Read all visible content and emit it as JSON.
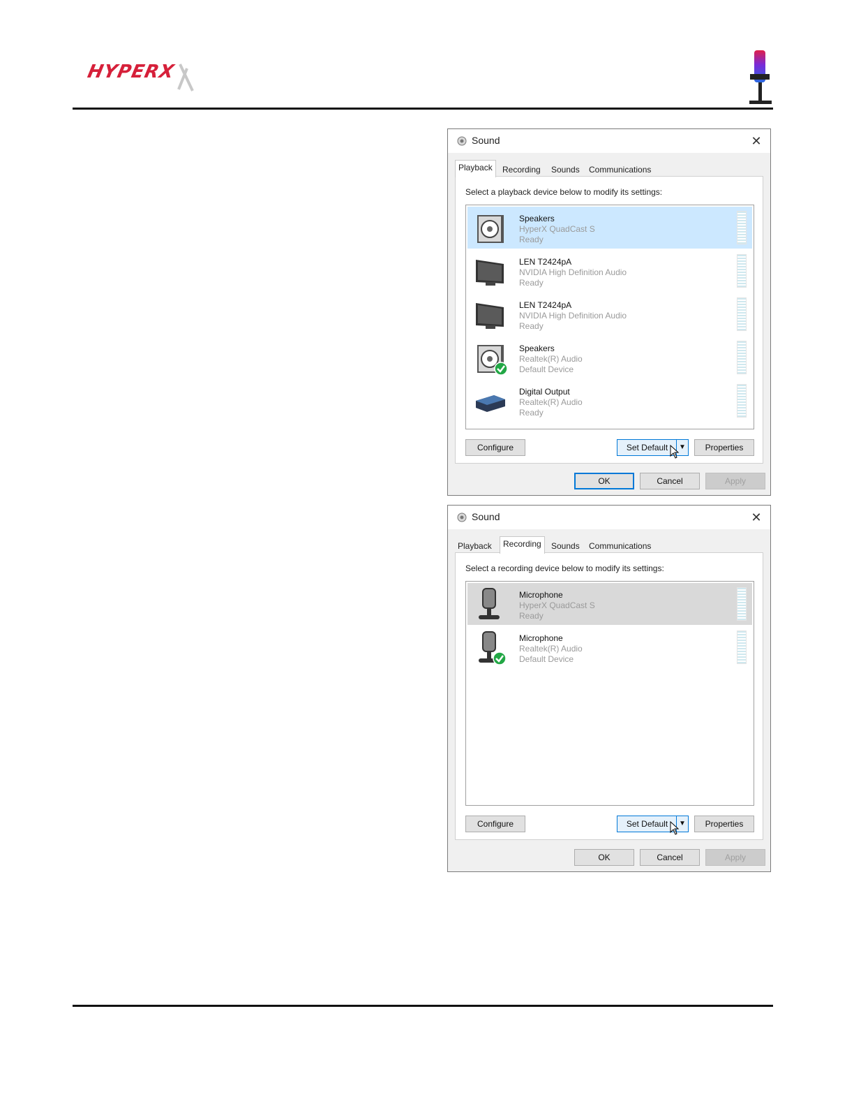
{
  "header": {
    "logo_text": "HYPERX"
  },
  "dialogs": [
    {
      "title": "Sound",
      "close": "✕",
      "tabs": [
        "Playback",
        "Recording",
        "Sounds",
        "Communications"
      ],
      "active_tab": "Playback",
      "instruction": "Select a playback device below to modify its settings:",
      "devices": [
        {
          "name": "Speakers",
          "sub": "HyperX QuadCast S",
          "status": "Ready",
          "icon": "speaker-icon",
          "selected": true,
          "default": false
        },
        {
          "name": "LEN T2424pA",
          "sub": "NVIDIA High Definition Audio",
          "status": "Ready",
          "icon": "monitor-icon",
          "selected": false,
          "default": false
        },
        {
          "name": "LEN T2424pA",
          "sub": "NVIDIA High Definition Audio",
          "status": "Ready",
          "icon": "monitor-icon",
          "selected": false,
          "default": false
        },
        {
          "name": "Speakers",
          "sub": "Realtek(R) Audio",
          "status": "Default Device",
          "icon": "speaker-icon",
          "selected": false,
          "default": true
        },
        {
          "name": "Digital Output",
          "sub": "Realtek(R) Audio",
          "status": "Ready",
          "icon": "digital-output-icon",
          "selected": false,
          "default": false
        }
      ],
      "buttons": {
        "configure": "Configure",
        "set_default": "Set Default",
        "properties": "Properties",
        "ok": "OK",
        "cancel": "Cancel",
        "apply": "Apply"
      }
    },
    {
      "title": "Sound",
      "close": "✕",
      "tabs": [
        "Playback",
        "Recording",
        "Sounds",
        "Communications"
      ],
      "active_tab": "Recording",
      "instruction": "Select a recording device below to modify its settings:",
      "devices": [
        {
          "name": "Microphone",
          "sub": "HyperX QuadCast S",
          "status": "Ready",
          "icon": "microphone-icon",
          "selected": true,
          "default": false
        },
        {
          "name": "Microphone",
          "sub": "Realtek(R) Audio",
          "status": "Default Device",
          "icon": "microphone-icon",
          "selected": false,
          "default": true
        }
      ],
      "buttons": {
        "configure": "Configure",
        "set_default": "Set Default",
        "properties": "Properties",
        "ok": "OK",
        "cancel": "Cancel",
        "apply": "Apply"
      }
    }
  ],
  "colors": {
    "brand_red": "#d6203a",
    "selection_blue": "#cce8ff",
    "selection_gray": "#d9d9d9",
    "accent_blue": "#0078d7",
    "check_green": "#22a745"
  }
}
